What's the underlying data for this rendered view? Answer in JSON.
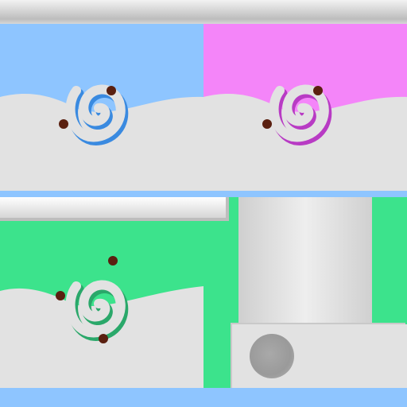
{
  "colors": {
    "blue_panel": "#8ec5ff",
    "pink_panel": "#f485f9",
    "green_panel": "#3ce38c",
    "ground": "#e2e2e2",
    "blue_swirl": "#3a8ae0",
    "pink_swirl": "#b83bc4",
    "green_swirl": "#2aa86a",
    "chip": "#5a2010"
  },
  "scene": {
    "cells": [
      {
        "name": "blue",
        "icon": "swirl-candy-icon"
      },
      {
        "name": "pink",
        "icon": "swirl-candy-icon"
      },
      {
        "name": "green",
        "icon": "swirl-candy-icon"
      }
    ],
    "extras": [
      "elevator-block",
      "round-hole"
    ]
  }
}
